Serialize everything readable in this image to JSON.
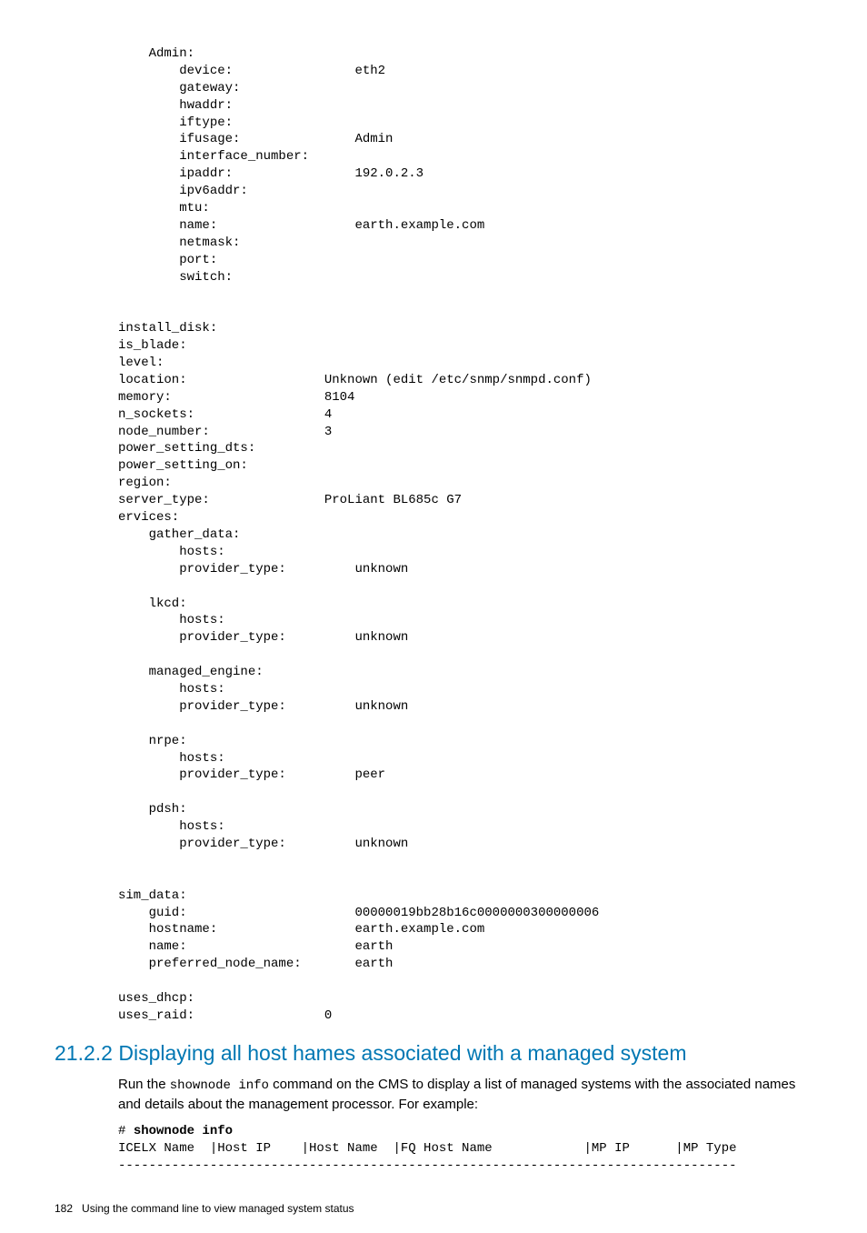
{
  "config_block": "    Admin:\n        device:                eth2\n        gateway:\n        hwaddr:\n        iftype:\n        ifusage:               Admin\n        interface_number:\n        ipaddr:                192.0.2.3\n        ipv6addr:\n        mtu:\n        name:                  earth.example.com\n        netmask:\n        port:\n        switch:\n\n\ninstall_disk:\nis_blade:\nlevel:\nlocation:                  Unknown (edit /etc/snmp/snmpd.conf)\nmemory:                    8104\nn_sockets:                 4\nnode_number:               3\npower_setting_dts:\npower_setting_on:\nregion:\nserver_type:               ProLiant BL685c G7\nervices:\n    gather_data:\n        hosts:\n        provider_type:         unknown\n\n    lkcd:\n        hosts:\n        provider_type:         unknown\n\n    managed_engine:\n        hosts:\n        provider_type:         unknown\n\n    nrpe:\n        hosts:\n        provider_type:         peer\n\n    pdsh:\n        hosts:\n        provider_type:         unknown\n\n\nsim_data:\n    guid:                      00000019bb28b16c0000000300000006\n    hostname:                  earth.example.com\n    name:                      earth\n    preferred_node_name:       earth\n\nuses_dhcp:\nuses_raid:                 0",
  "section": {
    "number": "21.2.2",
    "title": "Displaying all host hames associated with a managed system"
  },
  "paragraph": {
    "prefix": "Run the ",
    "command": "shownode info",
    "suffix": " command on the CMS to display a list of managed systems with the associated names and details about the management processor. For example:"
  },
  "example": {
    "prompt": "# ",
    "command": "shownode info",
    "header": "ICELX Name  |Host IP    |Host Name  |FQ Host Name            |MP IP      |MP Type",
    "separator": "---------------------------------------------------------------------------------"
  },
  "footer": {
    "page_number": "182",
    "title": "Using the command line to view managed system status"
  }
}
